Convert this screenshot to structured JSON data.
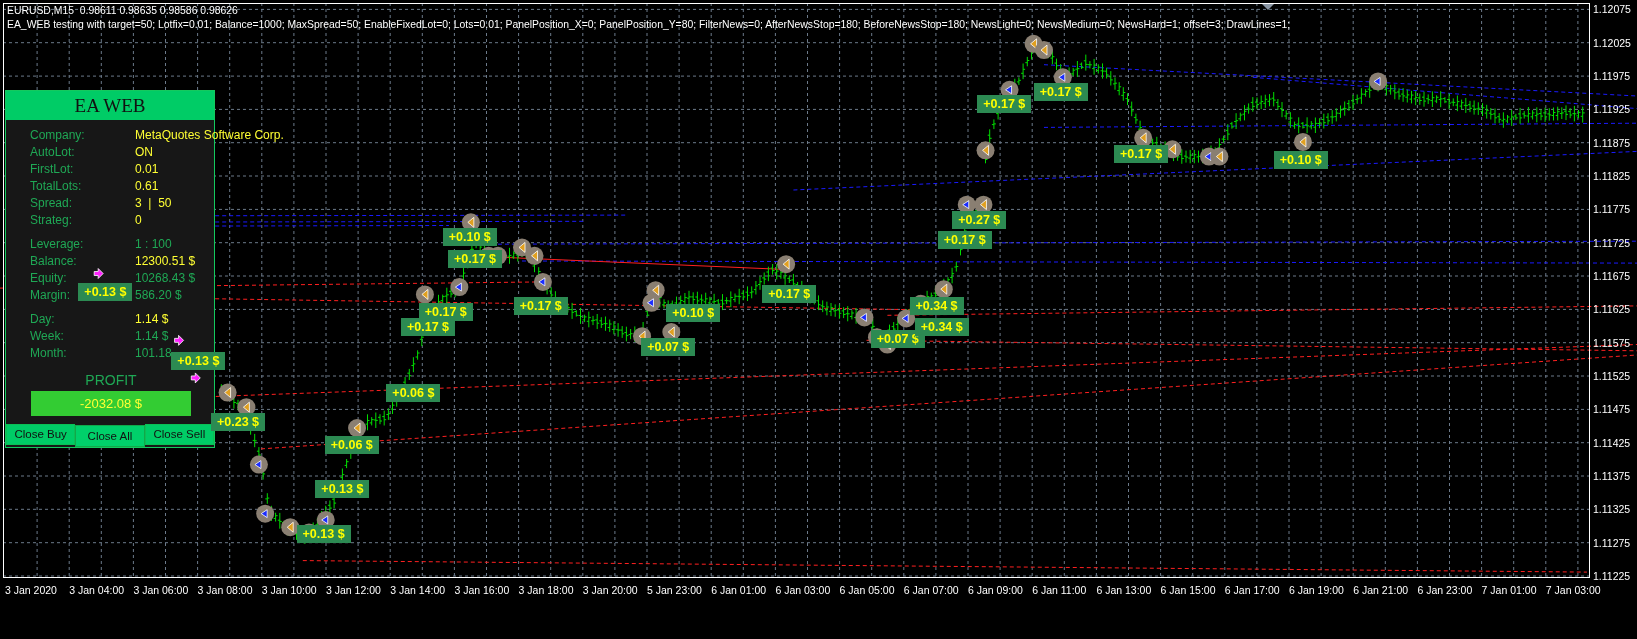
{
  "chart": {
    "symbol_line": "EURUSD,M15  0.98611 0.98635 0.98586 0.98626",
    "ea_line": "EA_WEB testing with target=50; Lotfix=0.01; Balance=1000; MaxSpread=50; EnableFixedLot=0; Lots=0.01; PanelPosition_X=0; PanelPosition_Y=80; FilterNews=0; AfterNewsStop=180; BeforeNewsStop=180; NewsLight=0; NewsMedium=0; NewsHard=1; offset=3; DrawLines=1;",
    "price_labels": [
      "1.12075",
      "1.12025",
      "1.11975",
      "1.11925",
      "1.11875",
      "1.11825",
      "1.11775",
      "1.11725",
      "1.11675",
      "1.11625",
      "1.11575",
      "1.11525",
      "1.11475",
      "1.11425",
      "1.11375",
      "1.11325",
      "1.11275",
      "1.11225"
    ],
    "time_labels": [
      "3 Jan 2020",
      "3 Jan 04:00",
      "3 Jan 06:00",
      "3 Jan 08:00",
      "3 Jan 10:00",
      "3 Jan 12:00",
      "3 Jan 14:00",
      "3 Jan 16:00",
      "3 Jan 18:00",
      "3 Jan 20:00",
      "5 Jan 23:00",
      "6 Jan 01:00",
      "6 Jan 03:00",
      "6 Jan 05:00",
      "6 Jan 07:00",
      "6 Jan 09:00",
      "6 Jan 11:00",
      "6 Jan 13:00",
      "6 Jan 15:00",
      "6 Jan 17:00",
      "6 Jan 19:00",
      "6 Jan 21:00",
      "6 Jan 23:00",
      "7 Jan 01:00",
      "7 Jan 03:00"
    ],
    "trade_labels": [
      {
        "text": "+0.13 $"
      },
      {
        "text": "+0.13 $"
      },
      {
        "text": "+0.23 $"
      },
      {
        "text": "+0.06 $"
      },
      {
        "text": "+0.13 $"
      },
      {
        "text": "+0.13 $"
      },
      {
        "text": "+0.06 $"
      },
      {
        "text": "+0.17 $"
      },
      {
        "text": "+0.17 $"
      },
      {
        "text": "+0.10 $"
      },
      {
        "text": "+0.17 $"
      },
      {
        "text": "+0.17 $"
      },
      {
        "text": "+0.07 $"
      },
      {
        "text": "+0.10 $"
      },
      {
        "text": "+0.17 $"
      },
      {
        "text": "+0.07 $"
      },
      {
        "text": "+0.34 $"
      },
      {
        "text": "+0.34 $"
      },
      {
        "text": "+0.27 $"
      },
      {
        "text": "+0.17 $"
      },
      {
        "text": "+0.17 $"
      },
      {
        "text": "+0.17 $"
      },
      {
        "text": "+0.17 $"
      },
      {
        "text": "+0.10 $"
      }
    ]
  },
  "panel": {
    "title": "EA WEB",
    "sections": [
      [
        {
          "label": "Company:",
          "value": "MetaQuotes Software Corp.",
          "color": "#ffff33"
        },
        {
          "label": "AutoLot:",
          "value": "ON",
          "color": "#ffff33"
        },
        {
          "label": "FirstLot:",
          "value": "0.01",
          "color": "#ffff33"
        },
        {
          "label": "TotalLots:",
          "value": "0.61",
          "color": "#ffff33"
        },
        {
          "label": "Spread:",
          "value": "3  |  50",
          "color": "#ffff33"
        },
        {
          "label": "Strateg:",
          "value": "0",
          "color": "#ffff33"
        }
      ],
      [
        {
          "label": "Leverage:",
          "value": "1 : 100",
          "color": "#1fa855"
        },
        {
          "label": "Balance:",
          "value": "12300.51 $",
          "color": "#ffff33"
        },
        {
          "label": "Equity:",
          "value": "10268.43 $",
          "color": "#1fa855"
        },
        {
          "label": "Margin:",
          "value": "586.20 $",
          "color": "#1fa855"
        }
      ],
      [
        {
          "label": "Day:",
          "value": "1.14 $",
          "color": "#ffff33"
        },
        {
          "label": "Week:",
          "value": "1.14 $",
          "color": "#1fa855"
        },
        {
          "label": "Month:",
          "value": "101.18",
          "color": "#1fa855"
        }
      ]
    ],
    "profit_label": "PROFIT",
    "profit_value": "-2032.08 $",
    "buttons": [
      {
        "label": "Close Buy",
        "selected": false
      },
      {
        "label": "Close All",
        "selected": true
      },
      {
        "label": "Close Sell",
        "selected": false
      }
    ]
  }
}
